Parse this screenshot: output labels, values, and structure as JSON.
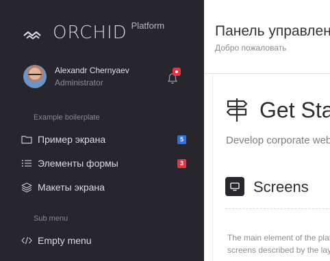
{
  "brand": {
    "name": "ORCHID",
    "sub": "Platform"
  },
  "profile": {
    "name": "Alexandr Chernyaev",
    "role": "Administrator"
  },
  "sections": [
    {
      "label": "Example boilerplate"
    },
    {
      "label": "Sub menu"
    }
  ],
  "menu": [
    {
      "label": "Пример экрана",
      "icon": "folder-icon",
      "badge": "5",
      "badge_color": "#2f6fe4"
    },
    {
      "label": "Элементы формы",
      "icon": "list-icon",
      "badge": "3",
      "badge_color": "#e7323f"
    },
    {
      "label": "Макеты экрана",
      "icon": "layers-icon"
    },
    {
      "label": "Empty menu",
      "icon": "code-icon"
    }
  ],
  "header": {
    "title": "Панель управления",
    "subtitle": "Добро пожаловать"
  },
  "hero": {
    "title": "Get Started",
    "text": "Develop corporate web applications"
  },
  "card": {
    "title": "Screens",
    "line1": "The main element of the platform",
    "line2": "screens described by the layouts"
  },
  "colors": {
    "sidebar": "#26262c",
    "badge_blue": "#2f6fe4",
    "badge_red": "#e7323f"
  }
}
